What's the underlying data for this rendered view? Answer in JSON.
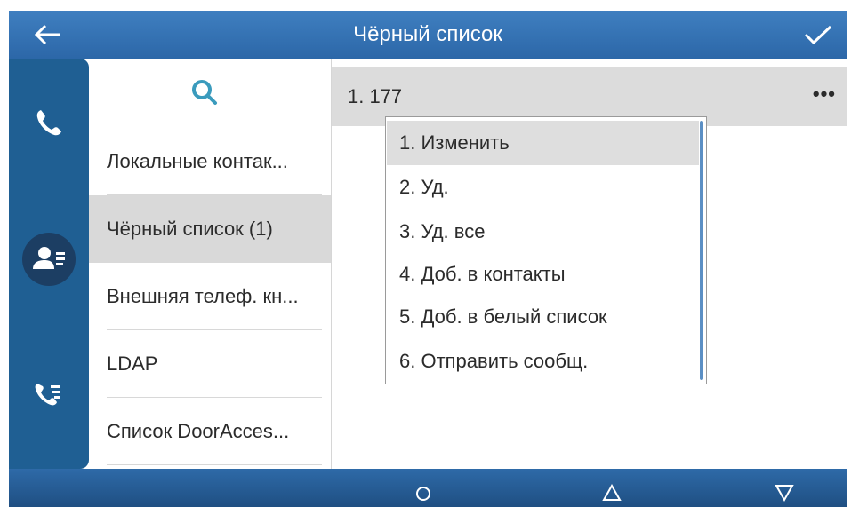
{
  "header": {
    "title": "Чёрный список",
    "back_icon": "arrow-left-icon",
    "confirm_icon": "checkmark-icon"
  },
  "rail": {
    "items": [
      {
        "icon": "phone-icon"
      },
      {
        "icon": "contacts-icon",
        "active": true
      },
      {
        "icon": "call-log-icon"
      }
    ]
  },
  "categories": {
    "search_icon": "search-icon",
    "items": [
      {
        "label": "Локальные контак..."
      },
      {
        "label": "Чёрный список (1)",
        "selected": true
      },
      {
        "label": "Внешняя телеф. кн..."
      },
      {
        "label": "LDAP"
      },
      {
        "label": "Список DoorAcces..."
      }
    ]
  },
  "list": {
    "entries": [
      {
        "label": "1. 177",
        "more": "•••"
      }
    ]
  },
  "context_menu": {
    "items": [
      {
        "label": "1. Изменить",
        "highlighted": true
      },
      {
        "label": "2. Уд."
      },
      {
        "label": "3. Уд. все"
      },
      {
        "label": "4. Доб. в контакты"
      },
      {
        "label": "5. Доб. в белый список"
      },
      {
        "label": "6. Отправить сообщ."
      }
    ]
  },
  "softkeys": [
    {
      "icon": "circle-icon"
    },
    {
      "icon": "triangle-up-icon"
    },
    {
      "icon": "triangle-down-icon"
    }
  ],
  "colors": {
    "header": "#3a78b8",
    "rail": "#1f5f93",
    "selection": "#d9d9d9",
    "accent": "#3a8fb6"
  }
}
